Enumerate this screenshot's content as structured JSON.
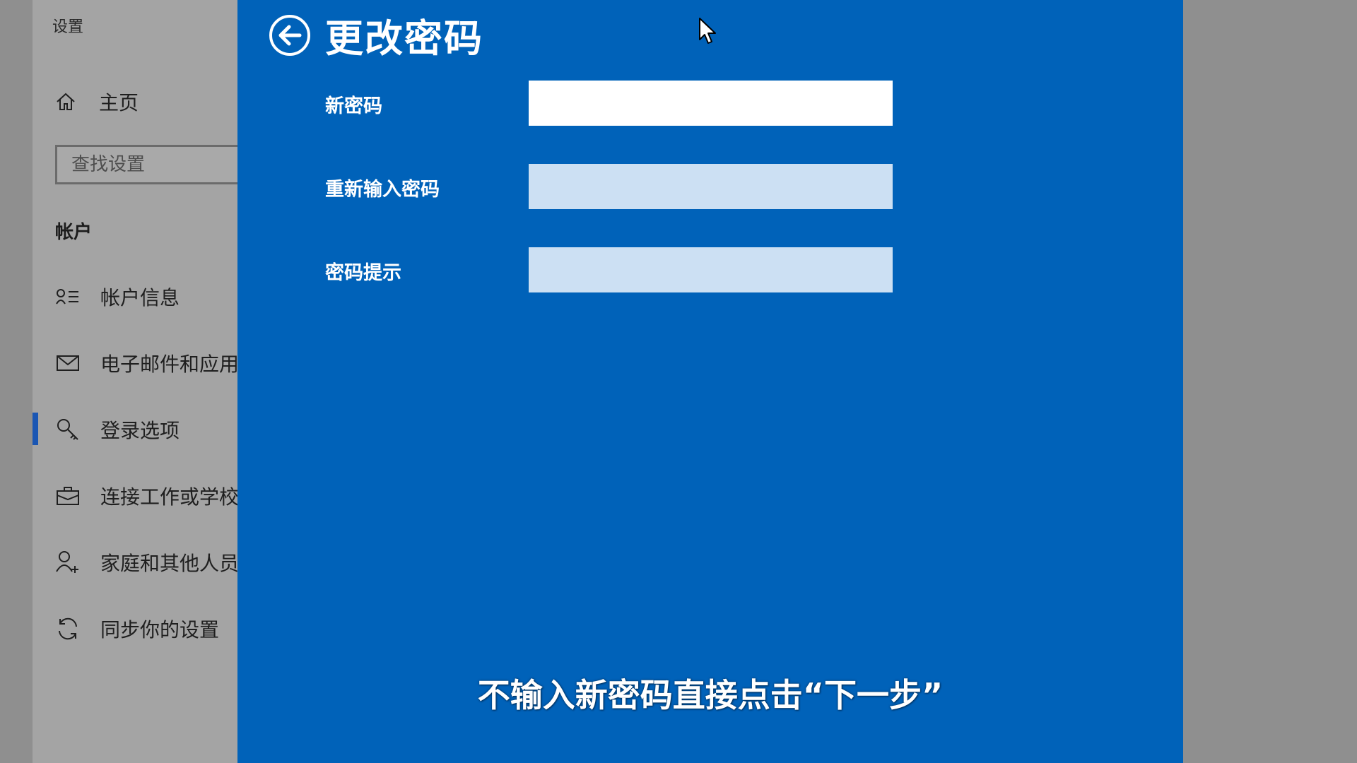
{
  "settings": {
    "window_title": "设置",
    "home_label": "主页",
    "search_placeholder": "查找设置",
    "section_heading": "帐户",
    "nav_items": [
      {
        "label": "帐户信息",
        "icon": "account-info-icon"
      },
      {
        "label": "电子邮件和应用",
        "icon": "mail-icon"
      },
      {
        "label": "登录选项",
        "icon": "key-icon",
        "active": true
      },
      {
        "label": "连接工作或学校",
        "icon": "briefcase-icon"
      },
      {
        "label": "家庭和其他人员",
        "icon": "person-add-icon"
      },
      {
        "label": "同步你的设置",
        "icon": "sync-icon"
      }
    ]
  },
  "dialog": {
    "title": "更改密码",
    "fields": [
      {
        "label": "新密码",
        "value": ""
      },
      {
        "label": "重新输入密码",
        "value": ""
      },
      {
        "label": "密码提示",
        "value": ""
      }
    ],
    "background_color": "#0062b9"
  },
  "subtitle": "不输入新密码直接点击“下一步”"
}
